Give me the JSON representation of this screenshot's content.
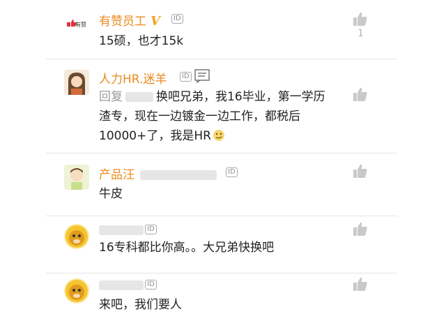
{
  "comments": [
    {
      "avatar_icon": "youzan-logo-icon",
      "avatar_text": "有赞",
      "name": "有赞员工",
      "verified": "V",
      "id_tag": "ID",
      "text": "15硕，也才15k",
      "likes": "1"
    },
    {
      "avatar_icon": "cartoon-girl-avatar-icon",
      "name": "人力HR.迷羊",
      "id_tag": "ID",
      "reply_prefix": "回复",
      "text_lines": [
        "换吧兄弟，我16毕业，第一学历",
        "渣专，现在一边镀金一边工作，都税后",
        "10000+了，我是HR"
      ],
      "emoji_icon": "smirk-emoji-icon"
    },
    {
      "avatar_icon": "cartoon-boy-avatar-icon",
      "name": "产品汪",
      "id_tag": "ID",
      "text": "牛皮"
    },
    {
      "avatar_icon": "monkey-avatar-icon",
      "id_tag": "ID",
      "text": "16专科都比你高。。大兄弟快换吧"
    },
    {
      "avatar_icon": "monkey-avatar-icon",
      "id_tag": "ID",
      "text": "来吧，我们要人"
    }
  ],
  "colors": {
    "name": "#ea8a1f",
    "like": "#c9c9c9",
    "divider": "#e5e5e5"
  }
}
